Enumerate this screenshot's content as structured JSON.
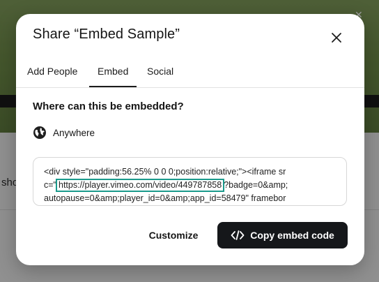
{
  "modal": {
    "title": "Share “Embed Sample”",
    "tabs": [
      {
        "label": "Add People",
        "active": false
      },
      {
        "label": "Embed",
        "active": true
      },
      {
        "label": "Social",
        "active": false
      }
    ],
    "embed": {
      "heading": "Where can this be embedded?",
      "location_option": "Anywhere",
      "location_icon": "globe-icon",
      "code": {
        "line1": "<div style=\"padding:56.25% 0 0 0;position:relative;\"><iframe sr",
        "line2_prefix": "c=\"",
        "line2_url": "https://player.vimeo.com/video/449787858",
        "line2_suffix": "?badge=0&amp;",
        "line3": "autopause=0&amp;player_id=0&amp;app_id=58479\" framebor"
      },
      "highlight_color": "#1a9a8c"
    },
    "buttons": {
      "customize": "Customize",
      "copy": "Copy embed code",
      "copy_icon": "code-brackets-icon"
    },
    "close_icon": "close-icon"
  },
  "background": {
    "page_text": "sho"
  },
  "colors": {
    "primary_button_bg": "#15171a",
    "text": "#151515"
  }
}
